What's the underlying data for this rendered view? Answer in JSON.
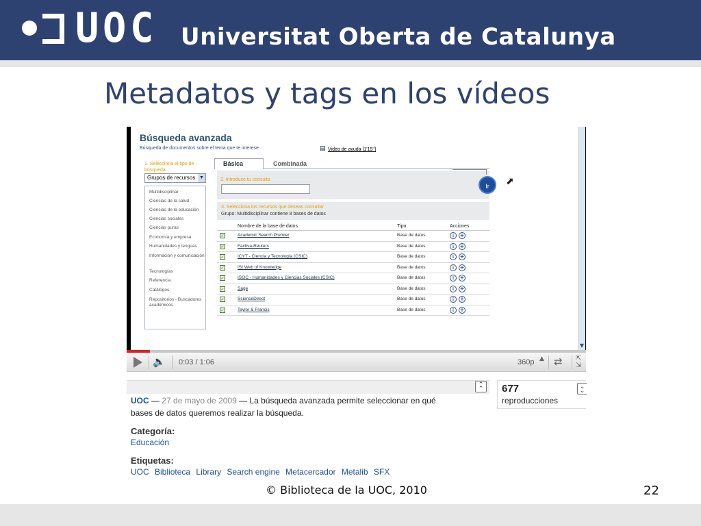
{
  "header": {
    "logo_text": "UOC",
    "university_name": "Universitat Oberta de Catalunya",
    "brand_color": "#2e4271"
  },
  "slide": {
    "title": "Metadatos y tags en los vídeos",
    "footer": "© Biblioteca de la UOC, 2010",
    "page_number": "22"
  },
  "video_content": {
    "heading": "Búsqueda avanzada",
    "subheading": "Búsqueda de documentos sobre el tema que te interese",
    "help_link": "Video de ayuda [1'15'']",
    "step1_label": "1. Selecciona el tipo de búsqueda",
    "select_value": "Grupos de recursos",
    "categories": [
      "Multidisciplinar",
      "Ciencias de la salud",
      "Ciencias de la educación",
      "Ciencias sociales",
      "Ciencias puras",
      "Economía y empresa",
      "Humanidades y lenguas",
      "Información y comunicación",
      "Tecnologías",
      "Referencia",
      "Catálogos",
      "Repositorios - Buscadores académicos"
    ],
    "tabs": [
      "Básica",
      "Combinada"
    ],
    "step2_label": "2. Introduce tu consulta",
    "go_button": "Ir",
    "step3_label": "3. Selecciona los recursos que deseas consultar",
    "group_info": "Grupo: Multidisciplinar contiene 8 bases de datos",
    "table_headers": [
      "Nombre de la base de datos",
      "Tipo",
      "Acciones"
    ],
    "rows": [
      {
        "name": "Academic Search Premier",
        "type": "Base de datos"
      },
      {
        "name": "Factiva-Reuters",
        "type": "Base de datos"
      },
      {
        "name": "ICYT - Ciencia y Tecnología (CSIC)",
        "type": "Base de datos"
      },
      {
        "name": "ISI Web of Knowledge",
        "type": "Base de datos"
      },
      {
        "name": "ISOC - Humanidades y Ciencias Sociales (CSIC)",
        "type": "Base de datos"
      },
      {
        "name": "Sage",
        "type": "Base de datos"
      },
      {
        "name": "ScienceDirect",
        "type": "Base de datos"
      },
      {
        "name": "Taylor & Francis",
        "type": "Base de datos"
      }
    ]
  },
  "player": {
    "time": "0:03 / 1:06",
    "progress": 0.05,
    "quality": "360p"
  },
  "description": {
    "author": "UOC",
    "date": "27 de mayo de 2009",
    "text_line1": "— La búsqueda avanzada permite seleccionar en qué",
    "text_line2": "bases de datos queremos realizar la búsqueda.",
    "category_label": "Categoría:",
    "category_value": "Educación",
    "tags_label": "Etiquetas:",
    "tags": [
      "UOC",
      "Biblioteca",
      "Library",
      "Search engine",
      "Metacercador",
      "Metalib",
      "SFX"
    ]
  },
  "stats": {
    "views": "677",
    "views_label": "reproducciones"
  }
}
